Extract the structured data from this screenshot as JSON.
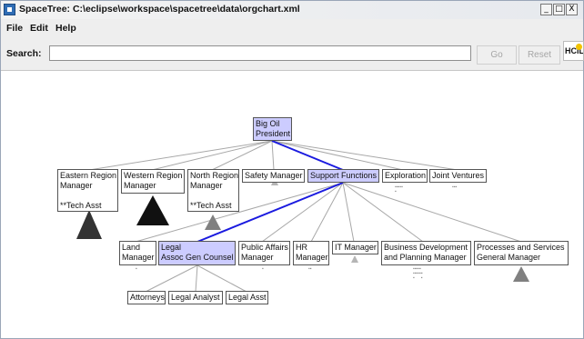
{
  "window": {
    "title": "SpaceTree: C:\\eclipse\\workspace\\spacetree\\data\\orgchart.xml",
    "controls": [
      "_",
      "□",
      "X"
    ]
  },
  "menu": [
    "File",
    "Edit",
    "Help"
  ],
  "search": {
    "label": "Search:",
    "value": "",
    "go_label": "Go",
    "reset_label": "Reset"
  },
  "logo": "HCIL",
  "tree": {
    "root": {
      "label": [
        "Big Oil",
        "President"
      ]
    },
    "level1": [
      {
        "label": [
          "Eastern Region",
          "Manager"
        ],
        "sublabel": "**Tech Asst"
      },
      {
        "label": [
          "Western Region",
          "Manager"
        ]
      },
      {
        "label": [
          "North Region",
          "Manager"
        ],
        "sublabel": "**Tech Asst"
      },
      {
        "label": [
          "Safety Manager"
        ]
      },
      {
        "label": [
          "Support Functions"
        ]
      },
      {
        "label": [
          "Exploration"
        ]
      },
      {
        "label": [
          "Joint Ventures"
        ]
      }
    ],
    "level2": [
      {
        "label": [
          "Land",
          "Manager"
        ]
      },
      {
        "label": [
          "Legal",
          "Assoc Gen Counsel"
        ]
      },
      {
        "label": [
          "Public Affairs",
          "Manager"
        ]
      },
      {
        "label": [
          "HR",
          "Manager"
        ]
      },
      {
        "label": [
          "IT Manager"
        ]
      },
      {
        "label": [
          "Business Development",
          "and Planning Manager"
        ]
      },
      {
        "label": [
          "Processes and Services",
          "General Manager"
        ]
      }
    ],
    "level3": [
      {
        "label": [
          "Attorneys"
        ]
      },
      {
        "label": [
          "Legal Analyst"
        ]
      },
      {
        "label": [
          "Legal Asst"
        ]
      }
    ]
  }
}
